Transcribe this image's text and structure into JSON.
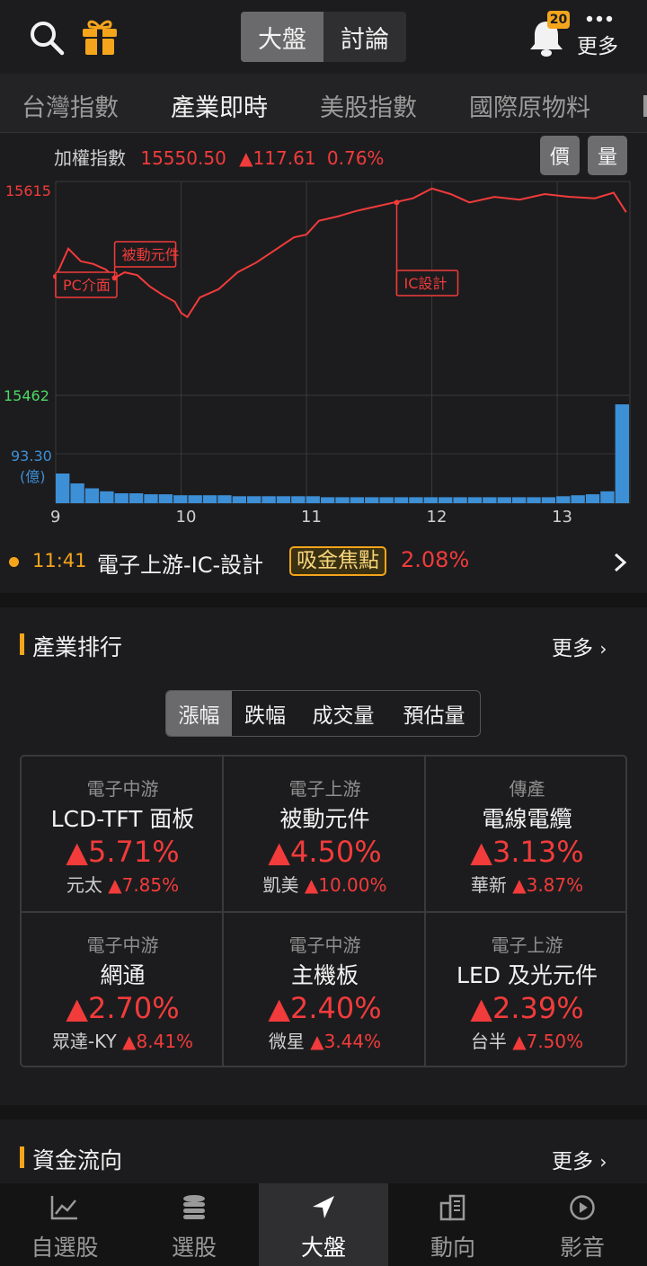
{
  "header": {
    "segments": [
      "大盤",
      "討論"
    ],
    "notification_count": "20",
    "more_label": "更多",
    "icons": [
      "search-icon",
      "gift-icon",
      "bell-icon",
      "more-dots-icon"
    ]
  },
  "tabs": [
    "台灣指數",
    "產業即時",
    "美股指數",
    "國際原物料"
  ],
  "index": {
    "name": "加權指數",
    "value": "15550.50",
    "change": "▲117.61",
    "pct": "0.76%",
    "price_btn": "價",
    "volume_btn": "量"
  },
  "chart_data": {
    "type": "line",
    "y_axis_labels": {
      "high": "15615",
      "low": "15462"
    },
    "ylim": [
      15462,
      15615
    ],
    "volume_label": "93.30",
    "volume_unit": "(億)",
    "x_ticks": [
      "9",
      "10",
      "11",
      "12",
      "13"
    ],
    "xlim": [
      9.0,
      13.58
    ],
    "series": [
      {
        "x": [
          9.0,
          9.1,
          9.2,
          9.3,
          9.4,
          9.47,
          9.55,
          9.65,
          9.75,
          9.85,
          9.95,
          10.0,
          10.05,
          10.15,
          10.3,
          10.45,
          10.6,
          10.75,
          10.9,
          11.0,
          11.1,
          11.25,
          11.4,
          11.55,
          11.7,
          11.85,
          12.0,
          12.15,
          12.3,
          12.5,
          12.7,
          12.9,
          13.1,
          13.3,
          13.45,
          13.55
        ],
        "y": [
          15547,
          15567,
          15558,
          15556,
          15552,
          15546,
          15550,
          15548,
          15540,
          15534,
          15529,
          15521,
          15518,
          15532,
          15538,
          15550,
          15557,
          15566,
          15575,
          15577,
          15587,
          15590,
          15594,
          15597,
          15600,
          15603,
          15610,
          15606,
          15600,
          15604,
          15602,
          15606,
          15604,
          15603,
          15607,
          15593
        ]
      }
    ],
    "volume_values": [
      30,
      20,
      15,
      12,
      10,
      10,
      9,
      9,
      8,
      8,
      8,
      8,
      7,
      7,
      7,
      7,
      7,
      7,
      6,
      6,
      6,
      6,
      6,
      6,
      6,
      6,
      6,
      6,
      6,
      6,
      6,
      6,
      6,
      6,
      7,
      8,
      9,
      12,
      100
    ],
    "annotations": [
      {
        "text": "PC介面",
        "x": 9.0
      },
      {
        "text": "被動元件",
        "x": 9.47
      },
      {
        "text": "IC設計",
        "x": 11.72
      }
    ]
  },
  "ticker": {
    "time": "11:41",
    "title": "電子上游-IC-設計",
    "tag": "吸金焦點",
    "pct": "2.08%"
  },
  "industry_rank": {
    "title": "產業排行",
    "more": "更多",
    "filters": [
      "漲幅",
      "跌幅",
      "成交量",
      "預估量"
    ],
    "cells": [
      {
        "category": "電子中游",
        "name": "LCD-TFT 面板",
        "pct": "▲5.71%",
        "stock": "元太",
        "stock_pct": "▲7.85%"
      },
      {
        "category": "電子上游",
        "name": "被動元件",
        "pct": "▲4.50%",
        "stock": "凱美",
        "stock_pct": "▲10.00%"
      },
      {
        "category": "傳產",
        "name": "電線電纜",
        "pct": "▲3.13%",
        "stock": "華新",
        "stock_pct": "▲3.87%"
      },
      {
        "category": "電子中游",
        "name": "網通",
        "pct": "▲2.70%",
        "stock": "眾達-KY",
        "stock_pct": "▲8.41%"
      },
      {
        "category": "電子中游",
        "name": "主機板",
        "pct": "▲2.40%",
        "stock": "微星",
        "stock_pct": "▲3.44%"
      },
      {
        "category": "電子上游",
        "name": "LED 及光元件",
        "pct": "▲2.39%",
        "stock": "台半",
        "stock_pct": "▲7.50%"
      }
    ]
  },
  "fund_flow": {
    "title": "資金流向",
    "more": "更多"
  },
  "bottom_nav": [
    "自選股",
    "選股",
    "大盤",
    "動向",
    "影音"
  ],
  "colors": {
    "up": "#f23b3b",
    "accent": "#f4a51c",
    "low": "#4cd964",
    "volume": "#3d8fd6"
  }
}
